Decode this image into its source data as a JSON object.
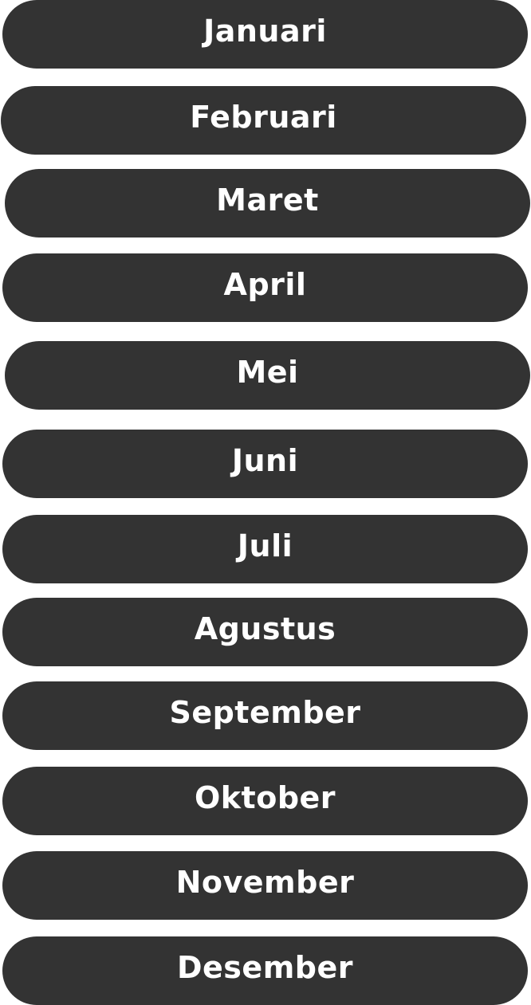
{
  "months": [
    {
      "label": "Januari"
    },
    {
      "label": "Februari"
    },
    {
      "label": "Maret"
    },
    {
      "label": "April"
    },
    {
      "label": "Mei"
    },
    {
      "label": "Juni"
    },
    {
      "label": "Juli"
    },
    {
      "label": "Agustus"
    },
    {
      "label": "September"
    },
    {
      "label": "Oktober"
    },
    {
      "label": "November"
    },
    {
      "label": "Desember"
    }
  ],
  "colors": {
    "button_bg": "#333333",
    "button_text": "#ffffff",
    "page_bg": "#ffffff"
  }
}
